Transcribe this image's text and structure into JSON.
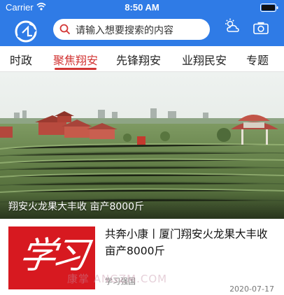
{
  "status_bar": {
    "carrier": "Carrier",
    "time": "8:50 AM",
    "icons": [
      "wifi-icon",
      "battery-icon"
    ]
  },
  "app_bar": {
    "logo_icon": "xiangan-logo-icon",
    "search_placeholder": "请输入想要搜索的内容",
    "icons": [
      "search-icon",
      "weather-icon",
      "camera-icon"
    ],
    "colors": {
      "bar": "#2f7be6",
      "accent": "#d23433"
    }
  },
  "tabs": [
    {
      "label": "时政",
      "active": false
    },
    {
      "label": "聚焦翔安",
      "active": true
    },
    {
      "label": "先锋翔安",
      "active": false
    },
    {
      "label": "业翔民安",
      "active": false
    },
    {
      "label": "专题",
      "active": false
    }
  ],
  "hero": {
    "caption": "翔安火龙果大丰收 亩产8000斤"
  },
  "article": {
    "thumbnail_text": "学习",
    "title": "共奔小康丨厦门翔安火龙果大丰收 亩产8000斤",
    "source": "学习强国",
    "date": "2020-07-17"
  },
  "watermark": "康掌 ANGZM.COM"
}
